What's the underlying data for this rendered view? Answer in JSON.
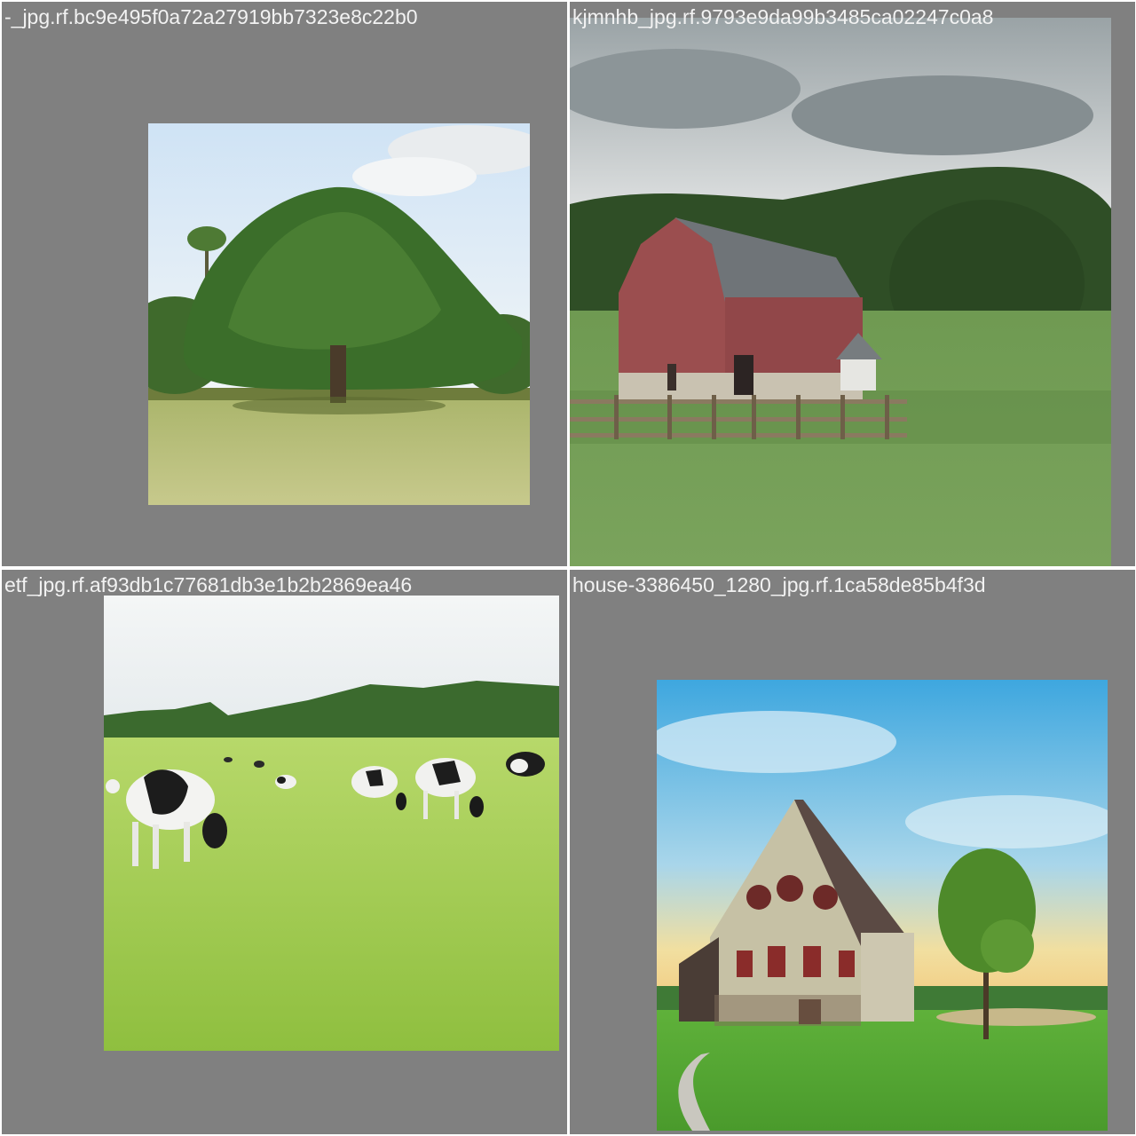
{
  "tiles": [
    {
      "caption": "-_jpg.rf.bc9e495f0a72a27919bb7323e8c22b0"
    },
    {
      "caption": "kjmnhb_jpg.rf.9793e9da99b3485ca02247c0a8"
    },
    {
      "caption": "etf_jpg.rf.af93db1c77681db3e1b2b2869ea46"
    },
    {
      "caption": "house-3386450_1280_jpg.rf.1ca58de85b4f3d"
    }
  ],
  "colors": {
    "tile_background": "#808080",
    "caption_text": "#f2f2f2",
    "separator": "#ffffff"
  }
}
